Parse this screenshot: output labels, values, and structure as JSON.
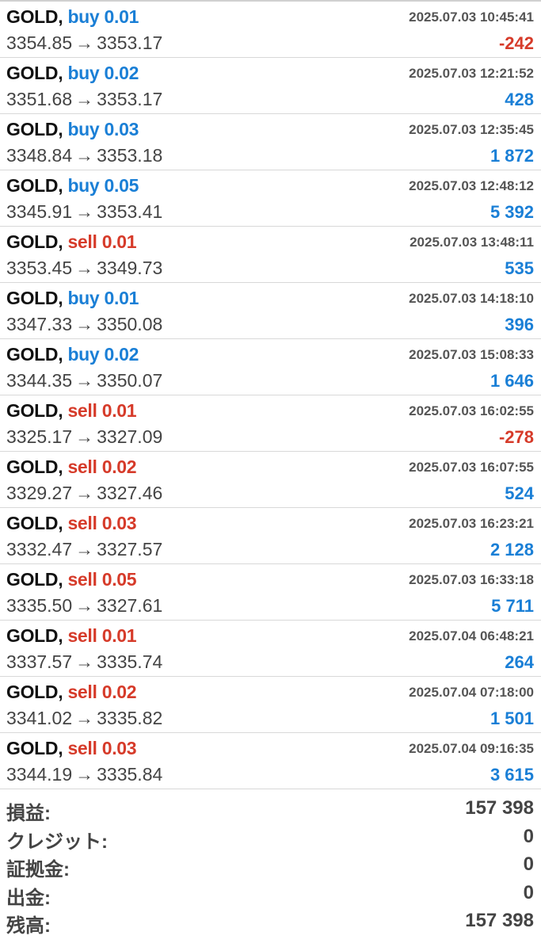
{
  "deals": [
    {
      "symbol": "GOLD",
      "type": "buy",
      "volume": "0.01",
      "time": "2025.07.03 10:45:41",
      "open": "3354.85",
      "close": "3353.17",
      "profit": "-242"
    },
    {
      "symbol": "GOLD",
      "type": "buy",
      "volume": "0.02",
      "time": "2025.07.03 12:21:52",
      "open": "3351.68",
      "close": "3353.17",
      "profit": "428"
    },
    {
      "symbol": "GOLD",
      "type": "buy",
      "volume": "0.03",
      "time": "2025.07.03 12:35:45",
      "open": "3348.84",
      "close": "3353.18",
      "profit": "1 872"
    },
    {
      "symbol": "GOLD",
      "type": "buy",
      "volume": "0.05",
      "time": "2025.07.03 12:48:12",
      "open": "3345.91",
      "close": "3353.41",
      "profit": "5 392"
    },
    {
      "symbol": "GOLD",
      "type": "sell",
      "volume": "0.01",
      "time": "2025.07.03 13:48:11",
      "open": "3353.45",
      "close": "3349.73",
      "profit": "535"
    },
    {
      "symbol": "GOLD",
      "type": "buy",
      "volume": "0.01",
      "time": "2025.07.03 14:18:10",
      "open": "3347.33",
      "close": "3350.08",
      "profit": "396"
    },
    {
      "symbol": "GOLD",
      "type": "buy",
      "volume": "0.02",
      "time": "2025.07.03 15:08:33",
      "open": "3344.35",
      "close": "3350.07",
      "profit": "1 646"
    },
    {
      "symbol": "GOLD",
      "type": "sell",
      "volume": "0.01",
      "time": "2025.07.03 16:02:55",
      "open": "3325.17",
      "close": "3327.09",
      "profit": "-278"
    },
    {
      "symbol": "GOLD",
      "type": "sell",
      "volume": "0.02",
      "time": "2025.07.03 16:07:55",
      "open": "3329.27",
      "close": "3327.46",
      "profit": "524"
    },
    {
      "symbol": "GOLD",
      "type": "sell",
      "volume": "0.03",
      "time": "2025.07.03 16:23:21",
      "open": "3332.47",
      "close": "3327.57",
      "profit": "2 128"
    },
    {
      "symbol": "GOLD",
      "type": "sell",
      "volume": "0.05",
      "time": "2025.07.03 16:33:18",
      "open": "3335.50",
      "close": "3327.61",
      "profit": "5 711"
    },
    {
      "symbol": "GOLD",
      "type": "sell",
      "volume": "0.01",
      "time": "2025.07.04 06:48:21",
      "open": "3337.57",
      "close": "3335.74",
      "profit": "264"
    },
    {
      "symbol": "GOLD",
      "type": "sell",
      "volume": "0.02",
      "time": "2025.07.04 07:18:00",
      "open": "3341.02",
      "close": "3335.82",
      "profit": "1 501"
    },
    {
      "symbol": "GOLD",
      "type": "sell",
      "volume": "0.03",
      "time": "2025.07.04 09:16:35",
      "open": "3344.19",
      "close": "3335.84",
      "profit": "3 615"
    }
  ],
  "summary": [
    {
      "label": "損益:",
      "value": "157 398"
    },
    {
      "label": "クレジット:",
      "value": "0"
    },
    {
      "label": "証拠金:",
      "value": "0"
    },
    {
      "label": "出金:",
      "value": "0"
    },
    {
      "label": "残高:",
      "value": "157 398"
    }
  ],
  "colors": {
    "buy": "#1a7fd6",
    "sell": "#d63b2a",
    "positive": "#1a7fd6",
    "negative": "#d63b2a"
  },
  "arrow_glyph": "→"
}
